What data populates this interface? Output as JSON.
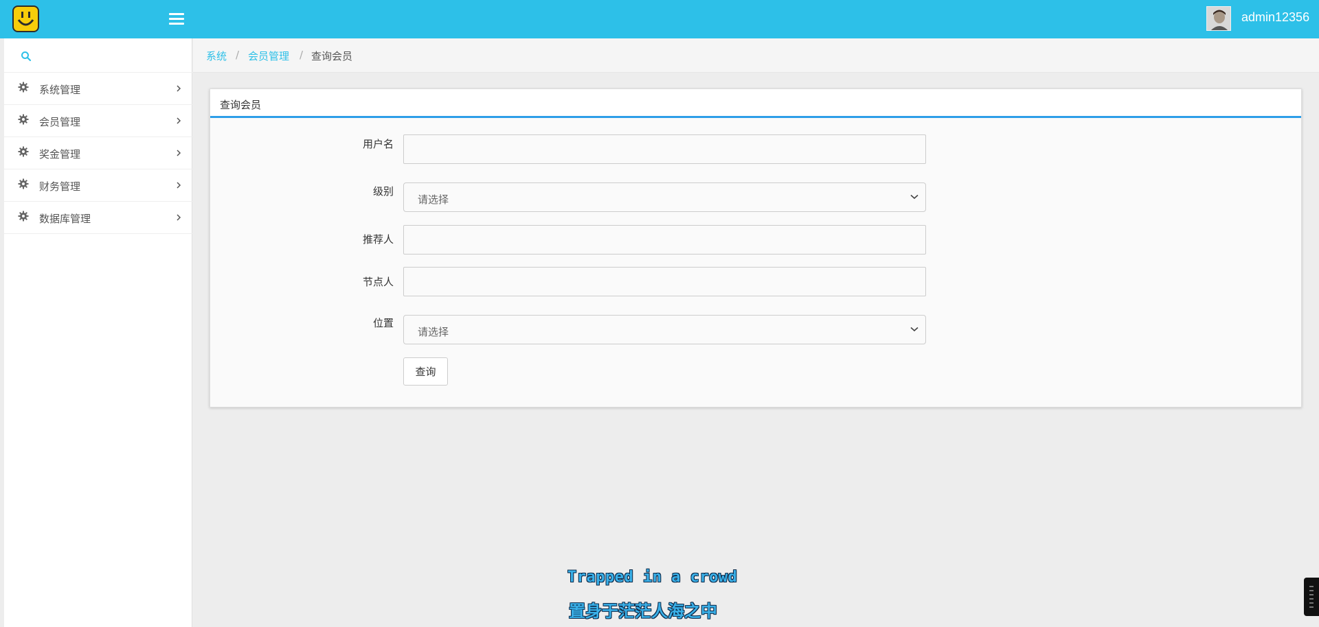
{
  "header": {
    "username": "admin12356"
  },
  "sidebar": {
    "items": [
      {
        "label": "系统管理"
      },
      {
        "label": "会员管理"
      },
      {
        "label": "奖金管理"
      },
      {
        "label": "财务管理"
      },
      {
        "label": "数据库管理"
      }
    ]
  },
  "breadcrumb": {
    "items": [
      "系统",
      "会员管理",
      "查询会员"
    ]
  },
  "panel": {
    "title": "查询会员",
    "fields": {
      "username_label": "用户名",
      "username_value": "",
      "level_label": "级别",
      "level_selected": "请选择",
      "referrer_label": "推荐人",
      "referrer_value": "",
      "node_label": "节点人",
      "node_value": "",
      "position_label": "位置",
      "position_selected": "请选择"
    },
    "query_button": "查询"
  },
  "subtitle": {
    "en": "Trapped in a crowd",
    "zh": "置身于茫茫人海之中"
  },
  "colors": {
    "topbar": "#2dc0e8",
    "link": "#2dc0e8",
    "panel_accent": "#2d9ee8",
    "logo": "#f7cd0a"
  },
  "icons": {
    "logo": "smiley-logo-icon",
    "menu": "hamburger-menu-icon",
    "search": "search-icon",
    "nav": "gear-icon",
    "chevron": "chevron-right-icon",
    "select": "chevron-down-icon"
  }
}
